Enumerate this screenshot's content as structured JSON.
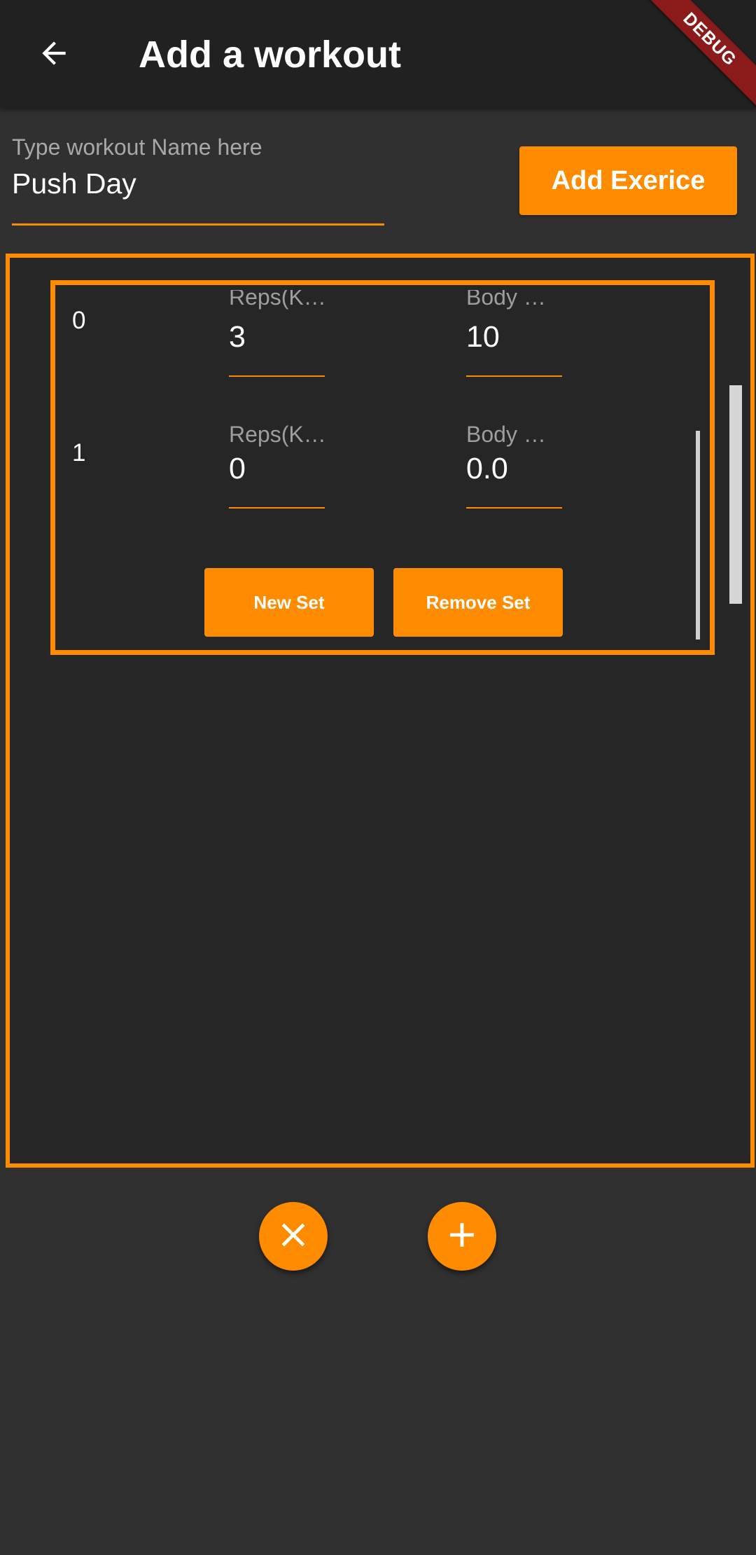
{
  "appbar": {
    "title": "Add a workout",
    "back_icon": "arrow-back-icon",
    "debug_label": "DEBUG"
  },
  "workout_name": {
    "label": "Type workout Name here",
    "value": "Push Day"
  },
  "add_exercise_label": "Add Exerice",
  "exercise": {
    "sets": [
      {
        "index": "0",
        "reps_label": "Reps(K…",
        "reps_value": "3",
        "body_label": "Body …",
        "body_value": "10"
      },
      {
        "index": "1",
        "reps_label": "Reps(K…",
        "reps_value": "0",
        "body_label": "Body …",
        "body_value": "0.0"
      }
    ],
    "new_set_label": "New Set",
    "remove_set_label": "Remove Set"
  },
  "fabs": {
    "cancel_icon": "close-icon",
    "add_icon": "plus-icon"
  },
  "colors": {
    "accent": "#ff8c00",
    "background": "#303030",
    "appbar": "#212121",
    "card": "#262626",
    "debug": "#8b1a1a"
  }
}
